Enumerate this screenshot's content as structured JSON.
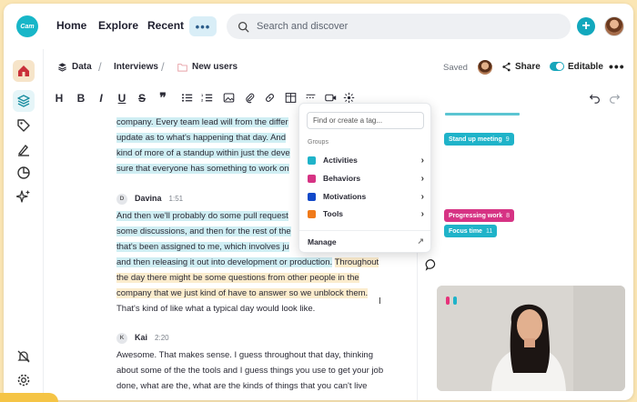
{
  "brand": {
    "logo_text": "Cam",
    "accent": "#12a8bd"
  },
  "nav": {
    "home": "Home",
    "explore": "Explore",
    "recent": "Recent",
    "more": "•••",
    "search_placeholder": "Search and discover",
    "add": "+"
  },
  "breadcrumb": {
    "items": [
      "Data",
      "Interviews",
      "New users"
    ],
    "separator": "/"
  },
  "doc_actions": {
    "saved": "Saved",
    "share": "Share",
    "editable": "Editable",
    "editable_on": true,
    "more": "•••"
  },
  "toolbar": {
    "heading": "H",
    "bold": "B",
    "italic": "I",
    "underline": "U",
    "strike": "S",
    "quote": "❞"
  },
  "transcript": {
    "lines_top": [
      "company. Every team lead will from the differ",
      "update as to what's happening that day. And",
      "kind of more of a standup within just the deve",
      "sure that everyone has something to work on"
    ],
    "speaker_davina": {
      "initial": "D",
      "name": "Davina",
      "time": "1:51"
    },
    "lines_davina": [
      "And then we'll probably do some pull request",
      "some discussions, and then for the rest of the",
      "that's been assigned to me, which involves ju",
      "and then releasing it out into development or production.",
      "Throughout",
      "the day there might be some questions from other people in the",
      "company that we just kind of have to answer so we unblock them.",
      "That's kind of like what a typical day would look like."
    ],
    "speaker_kai": {
      "initial": "K",
      "name": "Kai",
      "time": "2:20"
    },
    "lines_kai": [
      "Awesome. That makes sense. I guess throughout that day, thinking",
      "about some of the the tools and I guess things you use to get your job",
      "done, what are the, what are the kinds of things that you can't live"
    ]
  },
  "tag_dropdown": {
    "placeholder": "Find or create a tag...",
    "groups_label": "Groups",
    "groups": [
      {
        "label": "Activities",
        "color": "#1fb3c9"
      },
      {
        "label": "Behaviors",
        "color": "#d63384"
      },
      {
        "label": "Motivations",
        "color": "#1249c9"
      },
      {
        "label": "Tools",
        "color": "#f07a1a"
      }
    ],
    "manage": "Manage"
  },
  "tags": [
    {
      "label": "Stand up meeting",
      "count": "9",
      "color": "#1fb3c9"
    },
    {
      "label": "Progressing work",
      "count": "8",
      "color": "#d63384"
    },
    {
      "label": "Focus time",
      "count": "11",
      "color": "#1fb3c9"
    }
  ],
  "video": {
    "logo_colors": [
      "#e6337a",
      "#1fb3c9"
    ]
  }
}
